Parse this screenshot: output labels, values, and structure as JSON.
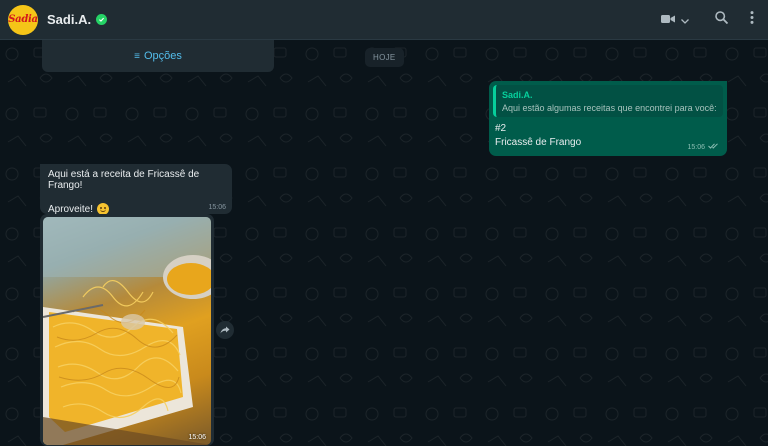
{
  "header": {
    "avatar_text": "Sadia",
    "contact_name": "Sadi.A.",
    "icons": [
      "verified-badge-icon",
      "video-call-icon",
      "chevron-down-icon",
      "search-icon",
      "menu-icon"
    ]
  },
  "chat": {
    "options_label": "Opções",
    "date_badge": "HOJE",
    "outgoing": {
      "quote_author": "Sadi.A.",
      "quote_text": "Aqui estão algumas receitas que encontrei para você:",
      "line1": "#2",
      "line2": "Fricassê de Frango",
      "time": "15:06"
    },
    "incoming": {
      "line1": "Aqui está a receita de Fricassê de Frango!",
      "line2": "Aproveite!",
      "time": "15:06"
    },
    "image_message": {
      "time": "15:06"
    }
  },
  "colors": {
    "background": "#0b141a",
    "header": "#202c33",
    "outgoing_bubble": "#005c4b",
    "incoming_bubble": "#202c33",
    "accent": "#06cf9c",
    "link": "#53bdeb",
    "brand_yellow": "#f5c518",
    "brand_red": "#d4161b"
  }
}
